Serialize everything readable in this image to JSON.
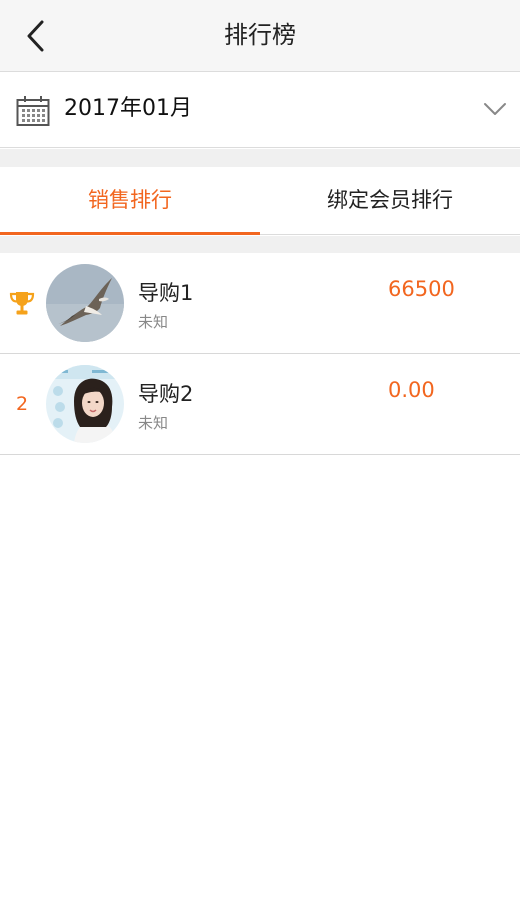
{
  "header": {
    "title": "排行榜"
  },
  "month_selector": {
    "value": "2017年01月"
  },
  "tabs": [
    {
      "label": "销售排行",
      "active": true
    },
    {
      "label": "绑定会员排行",
      "active": false
    }
  ],
  "ranking": [
    {
      "rank_icon": "trophy-icon",
      "name": "导购1",
      "subtitle": "未知",
      "amount": "66500",
      "avatar": "bird-photo"
    },
    {
      "rank": "2",
      "name": "导购2",
      "subtitle": "未知",
      "amount": "0.00",
      "avatar": "portrait-photo"
    }
  ],
  "colors": {
    "accent": "#f2661f",
    "header_bg": "#f6f6f6",
    "separator_bg": "#f0f0f0"
  }
}
